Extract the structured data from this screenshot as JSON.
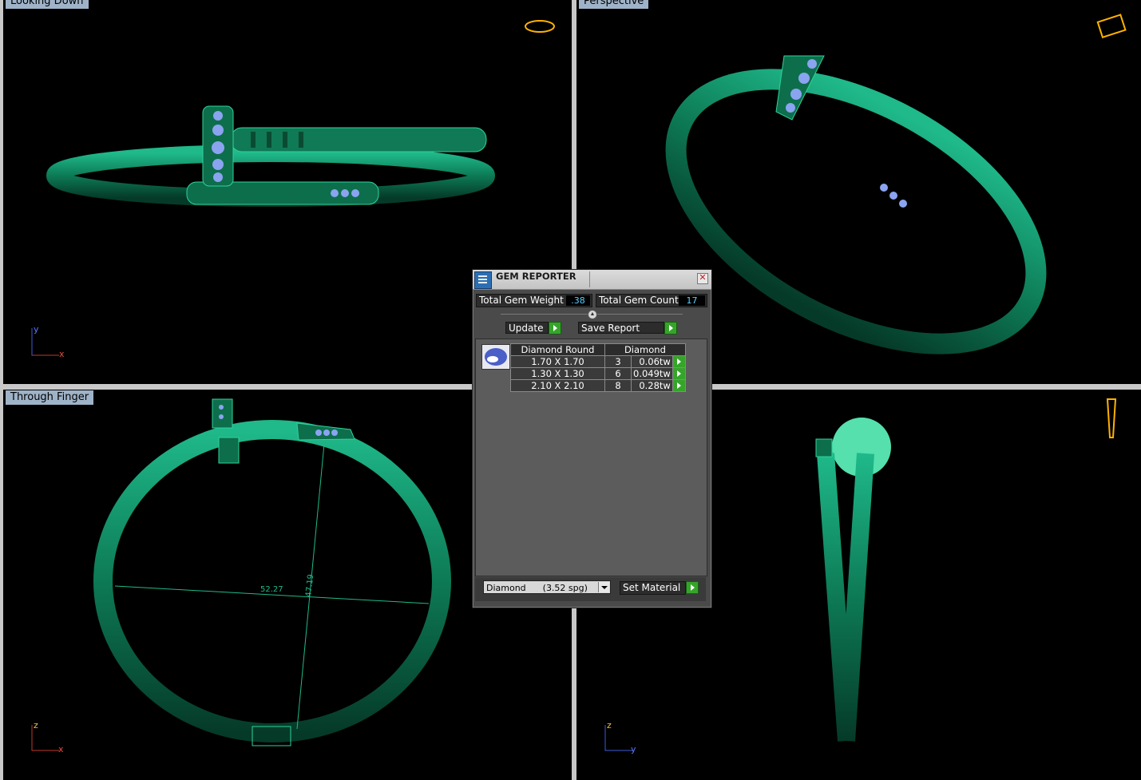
{
  "viewports": {
    "top_left": {
      "label": "Looking Down"
    },
    "top_right": {
      "label": "Perspective"
    },
    "bottom_left": {
      "label": "Through Finger",
      "dim_width": "52.27",
      "dim_height": "47.19"
    },
    "bottom_right": {
      "label": ""
    }
  },
  "axes": {
    "y": "y",
    "x": "x",
    "z": "z"
  },
  "gem_reporter": {
    "title": "GEM REPORTER",
    "close_glyph": "✕",
    "total_weight_label": "Total Gem Weight",
    "total_weight_value": ".38",
    "total_count_label": "Total Gem Count",
    "total_count_value": "17",
    "update_label": "Update",
    "save_report_label": "Save Report",
    "table_headers": [
      "Diamond Round",
      "Diamond"
    ],
    "rows": [
      {
        "size": "1.70 X 1.70",
        "count": "3",
        "weight": "0.06tw"
      },
      {
        "size": "1.30 X 1.30",
        "count": "6",
        "weight": "0.049tw"
      },
      {
        "size": "2.10 X 2.10",
        "count": "8",
        "weight": "0.28tw"
      }
    ],
    "material_value": "Diamond      (3.52 spg)",
    "set_material_label": "Set Material"
  },
  "colors": {
    "metal": "#0f7a55",
    "gem": "#6f8fe0",
    "background": "#000000",
    "label_bg": "#9fb3c8",
    "accent_green": "#35a52a"
  }
}
